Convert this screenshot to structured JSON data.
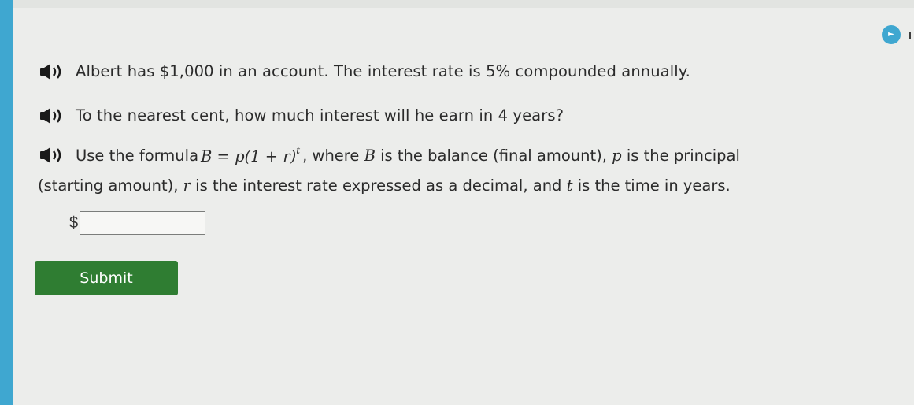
{
  "question": {
    "line1": "Albert has $1,000 in an account. The interest rate is 5% compounded annually.",
    "line2": "To the nearest cent, how much interest will he earn in 4 years?",
    "line3_prefix": "Use the formula",
    "formula_main": "B = p(1 + r)",
    "formula_exponent": "t",
    "line3_mid1": ", where",
    "var_B": "B",
    "line3_mid2": "is the balance (final amount),",
    "var_p": "p",
    "line3_mid3": "is the principal",
    "line4_prefix": "(starting amount),",
    "var_r": "r",
    "line4_mid": "is the interest rate expressed as a decimal, and",
    "var_t": "t",
    "line4_suffix": "is the time in years."
  },
  "answer": {
    "currency_symbol": "$",
    "value": "",
    "placeholder": ""
  },
  "submit_label": "Submit",
  "icons": {
    "speaker": "speaker-icon",
    "top_right": "help-circle-icon"
  },
  "colors": {
    "accent": "#3fa7d0",
    "submit": "#2f7d32",
    "background": "#ecedeb"
  }
}
